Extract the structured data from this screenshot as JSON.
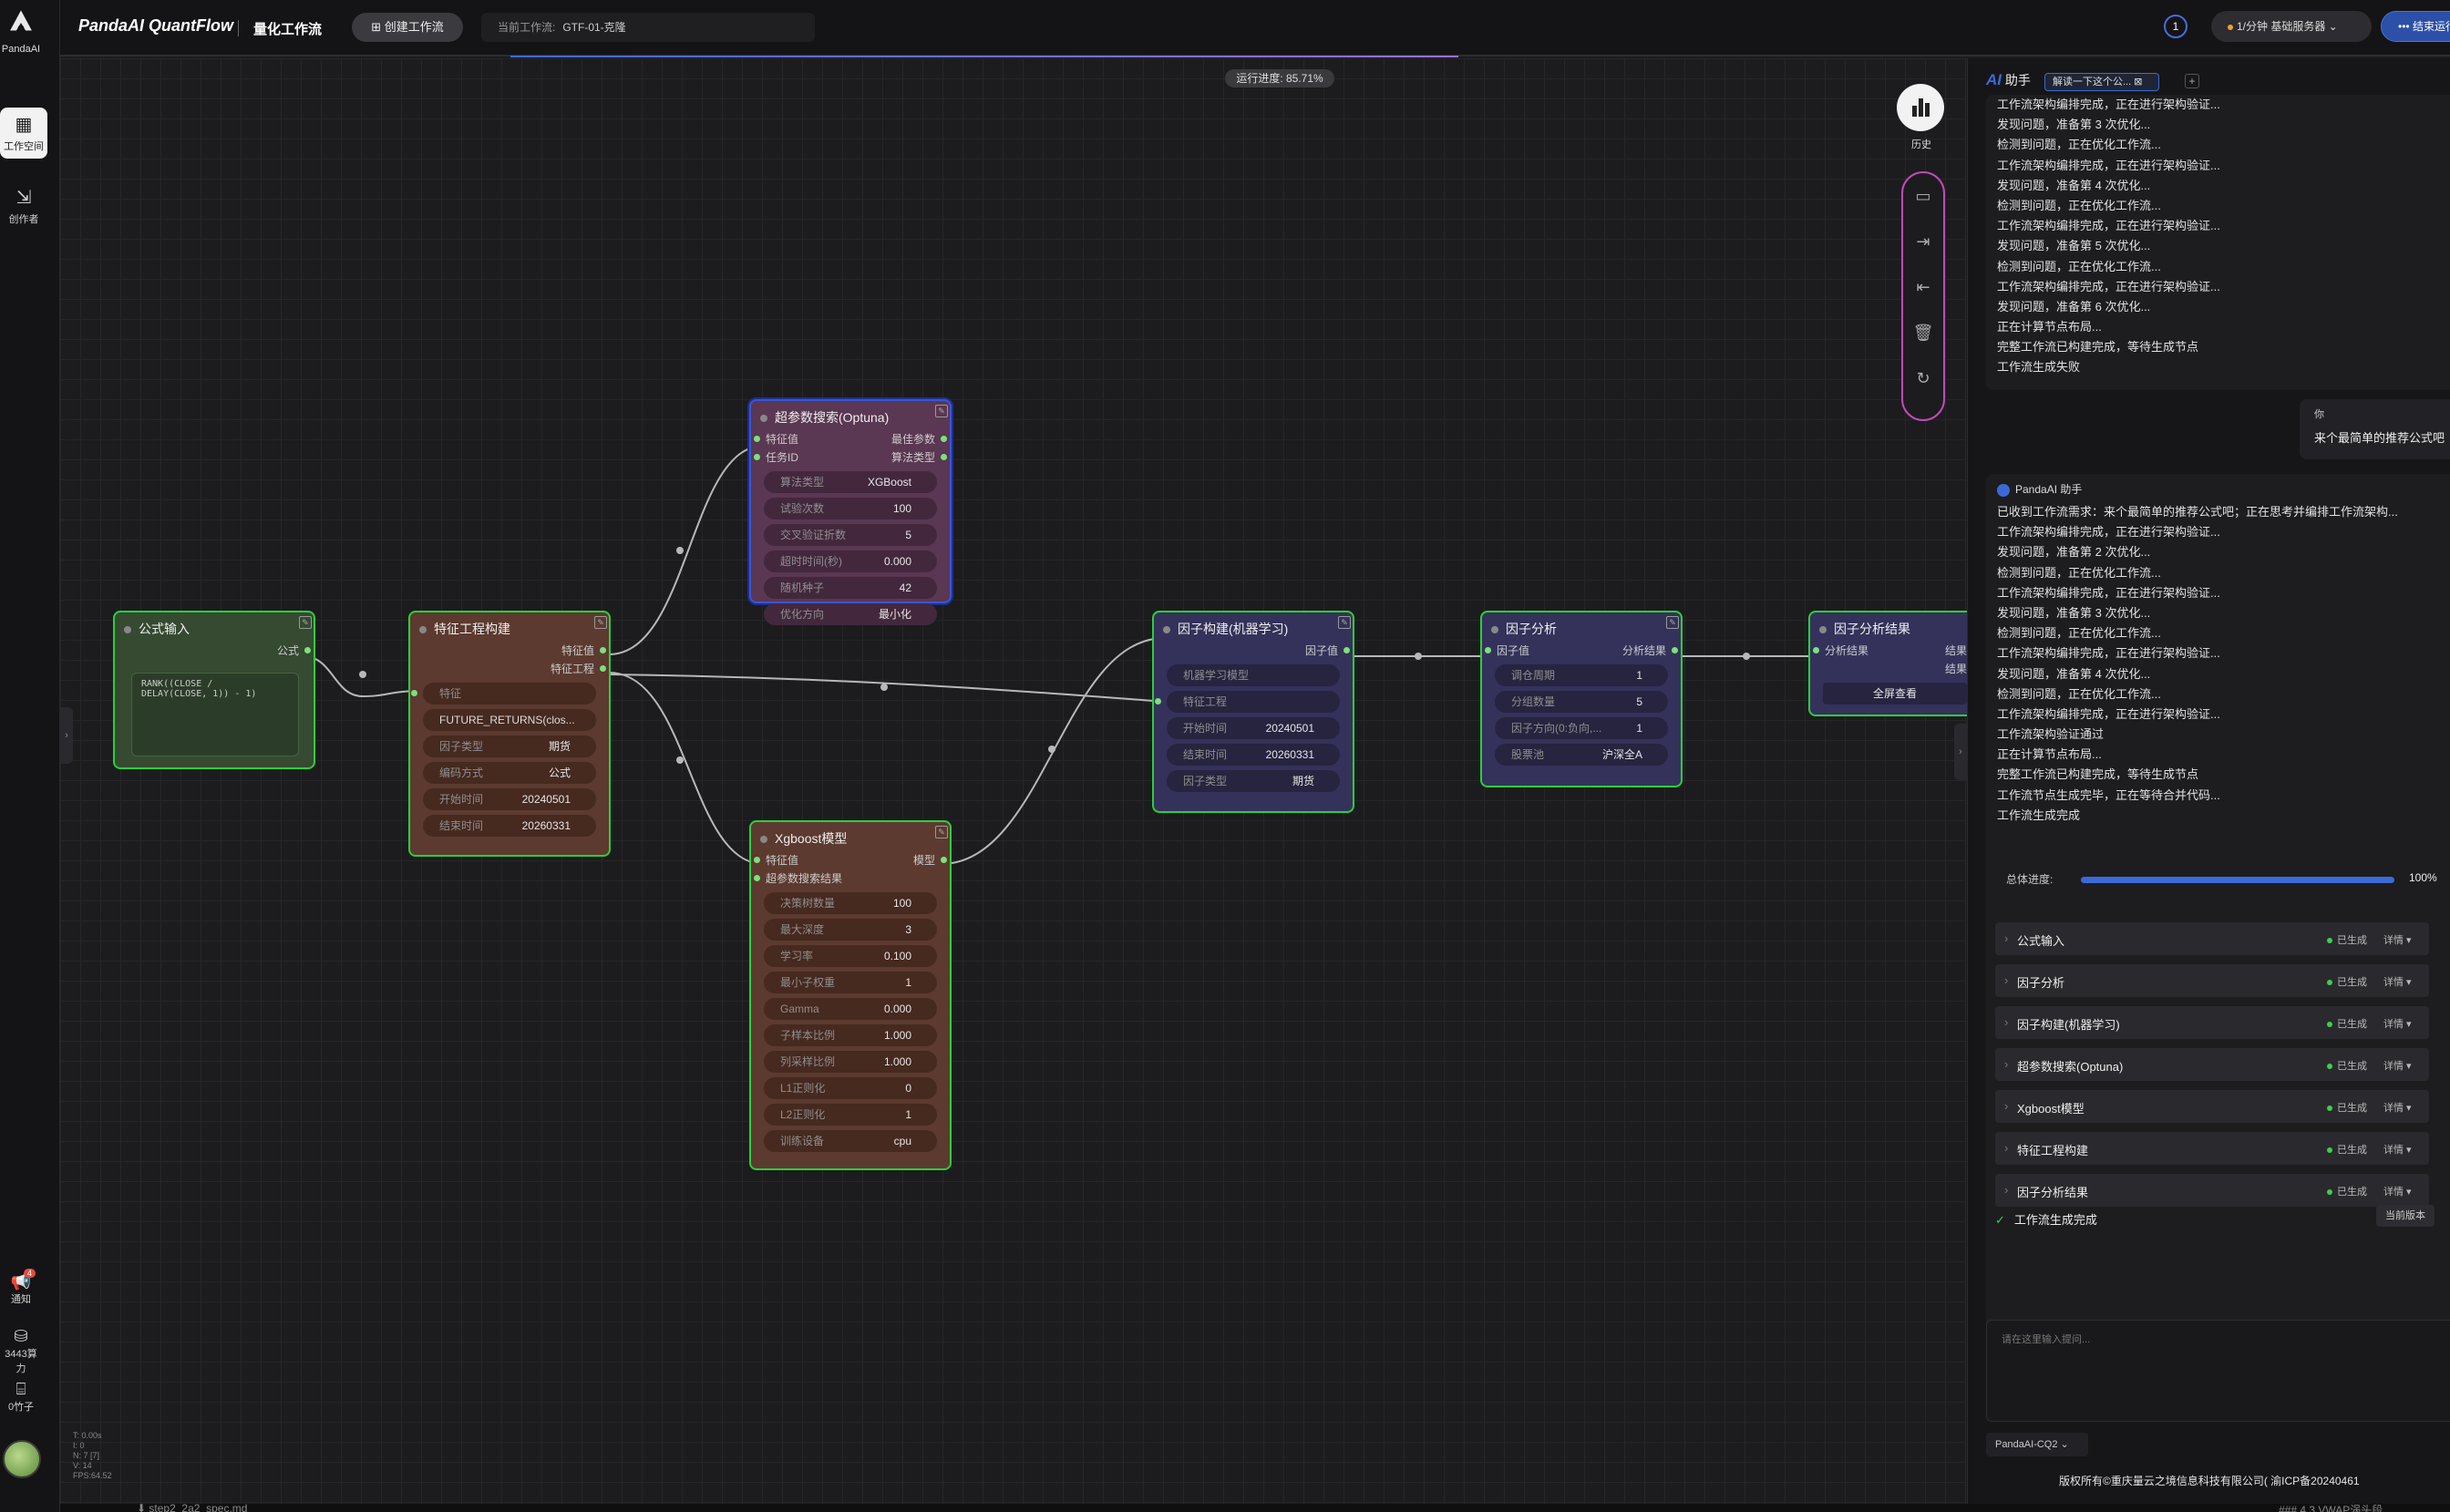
{
  "app": {
    "logo_text": "PandaAI",
    "brand": "PandaAI QuantFlow",
    "section": "量化工作流"
  },
  "rail": {
    "workspace": "工作空间",
    "creator": "创作者",
    "notify": "通知",
    "notify_badge": "4",
    "compute": "3443算力",
    "bamboo": "0竹子"
  },
  "topbar": {
    "create_label": "创建工作流",
    "current_label": "当前工作流:",
    "current_value": "GTF-01-克隆",
    "clock_num": "1",
    "service": "1/分钟  基础服务器",
    "end_label": "结束运行"
  },
  "canvas": {
    "progress": "运行进度: 85.71%",
    "history": "历史",
    "stats": [
      "T: 0.00s",
      "I: 0",
      "N: 7 [7]",
      "V: 14",
      "FPS:64.52"
    ]
  },
  "nodes": {
    "formula": {
      "title": "公式输入",
      "out": "公式",
      "code": "RANK((CLOSE /\nDELAY(CLOSE, 1)) - 1)"
    },
    "feature": {
      "title": "特征工程构建",
      "out1": "特征值",
      "out2": "特征工程",
      "in1": "特征",
      "fields": [
        {
          "k": "",
          "v": "FUTURE_RETURNS(clos..."
        },
        {
          "k": "因子类型",
          "v": "期货"
        },
        {
          "k": "编码方式",
          "v": "公式"
        },
        {
          "k": "开始时间",
          "v": "20240501"
        },
        {
          "k": "结束时间",
          "v": "20260331"
        }
      ]
    },
    "optuna": {
      "title": "超参数搜索(Optuna)",
      "in1": "特征值",
      "in2": "任务ID",
      "out1": "最佳参数",
      "out2": "算法类型",
      "fields": [
        {
          "k": "算法类型",
          "v": "XGBoost"
        },
        {
          "k": "试验次数",
          "v": "100"
        },
        {
          "k": "交叉验证折数",
          "v": "5"
        },
        {
          "k": "超时时间(秒)",
          "v": "0.000"
        },
        {
          "k": "随机种子",
          "v": "42"
        },
        {
          "k": "优化方向",
          "v": "最小化"
        }
      ]
    },
    "xgb": {
      "title": "Xgboost模型",
      "in1": "特征值",
      "in2": "超参数搜索结果",
      "out1": "模型",
      "fields": [
        {
          "k": "决策树数量",
          "v": "100"
        },
        {
          "k": "最大深度",
          "v": "3"
        },
        {
          "k": "学习率",
          "v": "0.100"
        },
        {
          "k": "最小子权重",
          "v": "1"
        },
        {
          "k": "Gamma",
          "v": "0.000"
        },
        {
          "k": "子样本比例",
          "v": "1.000"
        },
        {
          "k": "列采样比例",
          "v": "1.000"
        },
        {
          "k": "L1正则化",
          "v": "0"
        },
        {
          "k": "L2正则化",
          "v": "1"
        },
        {
          "k": "训练设备",
          "v": "cpu"
        }
      ]
    },
    "factor_ml": {
      "title": "因子构建(机器学习)",
      "out1": "因子值",
      "in1": "机器学习模型",
      "in2": "特征工程",
      "fields": [
        {
          "k": "开始时间",
          "v": "20240501"
        },
        {
          "k": "结束时间",
          "v": "20260331"
        },
        {
          "k": "因子类型",
          "v": "期货"
        }
      ]
    },
    "analysis": {
      "title": "因子分析",
      "in1": "因子值",
      "out1": "分析结果",
      "fields": [
        {
          "k": "调仓周期",
          "v": "1"
        },
        {
          "k": "分组数量",
          "v": "5"
        },
        {
          "k": "因子方向(0:负向,...",
          "v": "1"
        },
        {
          "k": "股票池",
          "v": "沪深全A"
        }
      ]
    },
    "result": {
      "title": "因子分析结果",
      "in1": "分析结果",
      "out1": "结果A",
      "out2": "结果B",
      "button": "全屏查看"
    }
  },
  "panel": {
    "title": "助手",
    "ai_mark": "AI",
    "tab": "解读一下这个公...",
    "top_lines": [
      "工作流架构编排完成，正在进行架构验证...",
      "发现问题，准备第 3 次优化...",
      "检测到问题，正在优化工作流...",
      "工作流架构编排完成，正在进行架构验证...",
      "发现问题，准备第 4 次优化...",
      "检测到问题，正在优化工作流...",
      "工作流架构编排完成，正在进行架构验证...",
      "发现问题，准备第 5 次优化...",
      "检测到问题，正在优化工作流...",
      "工作流架构编排完成，正在进行架构验证...",
      "发现问题，准备第 6 次优化...",
      "正在计算节点布局...",
      "完整工作流已构建完成，等待生成节点",
      "工作流生成失败"
    ],
    "user_who": "你",
    "user_msg": "来个最简单的推荐公式吧",
    "bot_name": "PandaAI 助手",
    "bot_lines": [
      "已收到工作流需求：来个最简单的推荐公式吧；正在思考并编排工作流架构...",
      "工作流架构编排完成，正在进行架构验证...",
      "发现问题，准备第 2 次优化...",
      "检测到问题，正在优化工作流...",
      "工作流架构编排完成，正在进行架构验证...",
      "发现问题，准备第 3 次优化...",
      "检测到问题，正在优化工作流...",
      "工作流架构编排完成，正在进行架构验证...",
      "发现问题，准备第 4 次优化...",
      "检测到问题，正在优化工作流...",
      "工作流架构编排完成，正在进行架构验证...",
      "工作流架构验证通过",
      "正在计算节点布局...",
      "完整工作流已构建完成，等待生成节点",
      "工作流节点生成完毕，正在等待合并代码...",
      "工作流生成完成"
    ],
    "overall_label": "总体进度:",
    "overall_value": 1.0,
    "overall_pct": "100%",
    "items": [
      {
        "name": "公式输入",
        "status": "已生成",
        "detail": "详情 ▾"
      },
      {
        "name": "因子分析",
        "status": "已生成",
        "detail": "详情 ▾"
      },
      {
        "name": "因子构建(机器学习)",
        "status": "已生成",
        "detail": "详情 ▾"
      },
      {
        "name": "超参数搜索(Optuna)",
        "status": "已生成",
        "detail": "详情 ▾"
      },
      {
        "name": "Xgboost模型",
        "status": "已生成",
        "detail": "详情 ▾"
      },
      {
        "name": "特征工程构建",
        "status": "已生成",
        "detail": "详情 ▾"
      },
      {
        "name": "因子分析结果",
        "status": "已生成",
        "detail": "详情 ▾"
      }
    ],
    "done": "工作流生成完成",
    "current_version": "当前版本",
    "input_placeholder": "请在这里输入提问...",
    "model": "PandaAI-CQ2",
    "footer": "版权所有©重庆量云之境信息科技有限公司( 渝ICP备20240461"
  },
  "strip": {
    "file": "step2_2a2_spec.md",
    "right": "### 4.3 VWAP涡头段"
  }
}
